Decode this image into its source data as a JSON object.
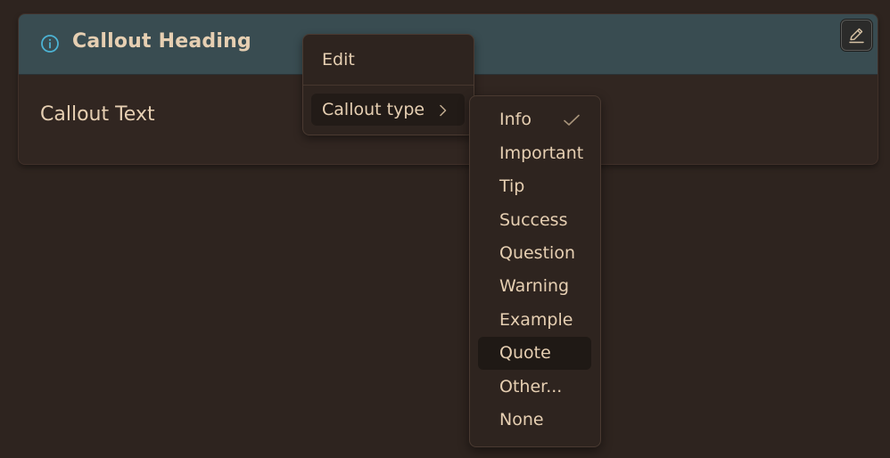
{
  "callout": {
    "heading": "Callout Heading",
    "text": "Callout Text",
    "header_color": "#394c51",
    "icon": "info-circle-icon",
    "edit_icon": "pencil-edit-icon"
  },
  "menu": {
    "edit_label": "Edit",
    "callout_type_label": "Callout type",
    "submenu_indicator_icon": "chevron-right-icon"
  },
  "submenu": {
    "selected": "Info",
    "hovered": "Quote",
    "items": [
      "Info",
      "Important",
      "Tip",
      "Success",
      "Question",
      "Warning",
      "Example",
      "Quote",
      "Other...",
      "None"
    ]
  }
}
